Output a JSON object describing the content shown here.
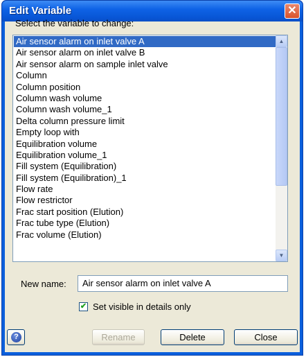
{
  "dialog": {
    "title": "Edit Variable",
    "close_glyph": "✕"
  },
  "list": {
    "prompt": "Select the variable to change:",
    "items": [
      "Air sensor alarm on inlet valve A",
      "Air sensor alarm on inlet valve B",
      "Air sensor alarm on sample inlet valve",
      "Column",
      "Column position",
      "Column wash volume",
      "Column wash volume_1",
      "Delta column pressure limit",
      "Empty loop with",
      "Equilibration volume",
      "Equilibration volume_1",
      "Fill system (Equilibration)",
      "Fill system (Equilibration)_1",
      "Flow rate",
      "Flow restrictor",
      "Frac start position (Elution)",
      "Frac tube type (Elution)",
      "Frac volume (Elution)"
    ],
    "selected_index": 0
  },
  "new_name": {
    "label": "New name:",
    "value": "Air sensor alarm on inlet valve A"
  },
  "visible_option": {
    "label": "Set visible in details only",
    "checked": true,
    "check_glyph": "✔"
  },
  "buttons": {
    "help_glyph": "?",
    "rename": "Rename",
    "delete": "Delete",
    "close": "Close"
  },
  "icons": {
    "scroll_up": "scroll-up-arrow-icon",
    "scroll_down": "scroll-down-arrow-icon",
    "help": "help-icon",
    "close": "close-icon"
  },
  "colors": {
    "titlebar": "#0b5fdc",
    "selection": "#316ac5",
    "dialog_face": "#ece9d8",
    "close_button": "#d9532b"
  }
}
